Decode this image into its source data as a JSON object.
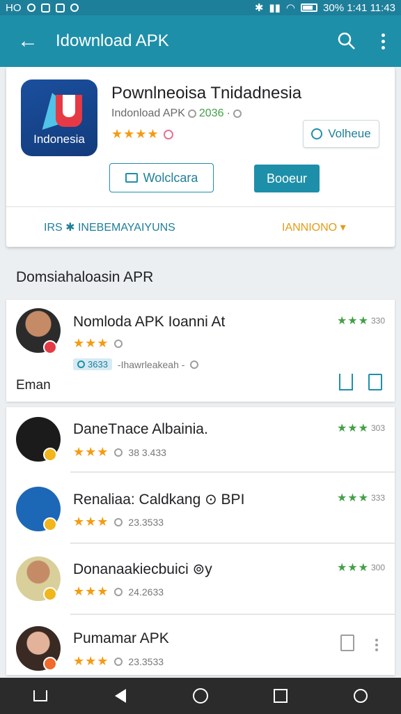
{
  "status_bar": {
    "left": "HO",
    "right": "30% 1:41 11:43"
  },
  "app_bar": {
    "title": "Idownload APK"
  },
  "hero": {
    "title": "Pownlneoisa Tnidadnesia",
    "subtitle_prefix": "Indonload APK",
    "subtitle_count": "2036",
    "stars": "★★★★",
    "icon_label": "Indonesia",
    "install_label": "Wolclcara",
    "open_label": "Booeur",
    "small_button_label": "Volheue",
    "link_left": "IRS ✱ INEBEMAYAIYUNS",
    "link_right": "IANNIONO ▾"
  },
  "section_heading": "Domsiahaloasin APR",
  "featured": {
    "title": "Nomloda APK Ioanni At",
    "stars": "★★★",
    "rating_stars": "★★★",
    "rating": "330",
    "badge": "3633",
    "meta_text": "-Ihawrleakeah -",
    "extra_label": "Eman"
  },
  "list_items": [
    {
      "title": "DaneTnace Albainia.",
      "stars": "★★★",
      "meta": "38 3.433",
      "rating_stars": "★★★",
      "rating": "303"
    },
    {
      "title": "Renaliaa: Caldkang ⊙ BPI",
      "stars": "★★★",
      "meta": "23.3533",
      "rating_stars": "★★★",
      "rating": "333"
    },
    {
      "title": "Donanaakiecbuici ⊚y",
      "stars": "★★★",
      "meta": "24.2633",
      "rating_stars": "★★★",
      "rating": "300"
    },
    {
      "title": "Pumamar APK",
      "stars": "★★★",
      "meta": "23.3533"
    }
  ],
  "colors": {
    "primary": "#1e8fa9",
    "star": "#f39c12",
    "green_star": "#43a047"
  },
  "icons": [
    "back-arrow-icon",
    "search-icon",
    "more-vert-icon",
    "clock-icon",
    "share-icon",
    "document-icon",
    "home-icon",
    "nav-back-icon",
    "nav-home-circle-icon",
    "recents-icon",
    "assistant-icon"
  ]
}
